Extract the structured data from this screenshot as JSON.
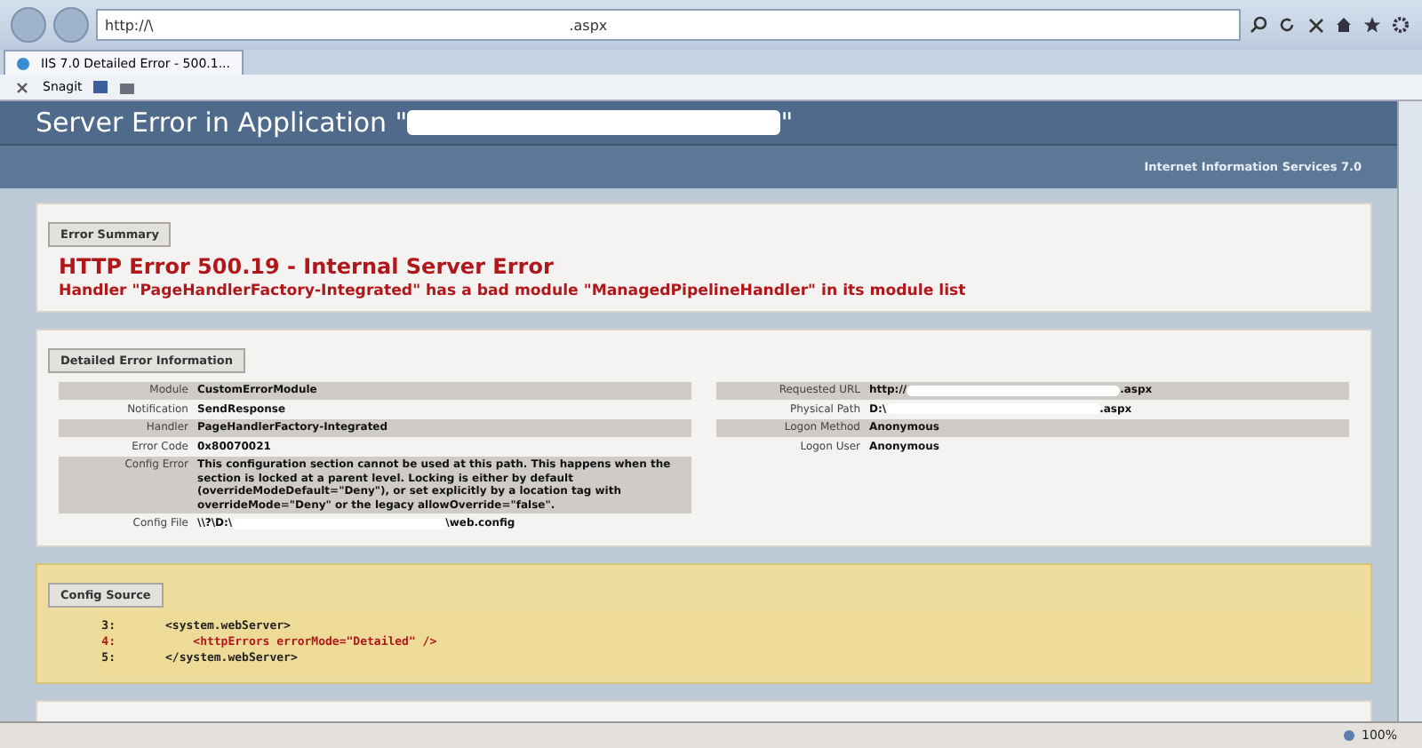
{
  "browser": {
    "address_prefix": "http://\\",
    "address_redacted": true,
    "address_suffix": ".aspx",
    "tabs": [
      {
        "title": "IIS 7.0 Detailed Error - 500.1...",
        "selected": true
      }
    ],
    "toolbar_label": "Snagit",
    "zoom": "100%"
  },
  "header": {
    "title_prefix": "Server Error in Application \"",
    "title_redacted": true,
    "title_suffix": "\"",
    "product": "Internet Information Services 7.0"
  },
  "summary": {
    "heading": "Error Summary",
    "title": "HTTP Error 500.19 - Internal Server Error",
    "message": "Handler \"PageHandlerFactory-Integrated\" has a bad module \"ManagedPipelineHandler\" in its module list"
  },
  "details": {
    "heading": "Detailed Error Information",
    "left": [
      {
        "label": "Module",
        "value": "CustomErrorModule",
        "redacted": false
      },
      {
        "label": "Notification",
        "value": "SendResponse",
        "redacted": false
      },
      {
        "label": "Handler",
        "value": "PageHandlerFactory-Integrated",
        "redacted": false
      },
      {
        "label": "Error Code",
        "value": "0x80070021",
        "redacted": false
      },
      {
        "label": "Config Error",
        "value": "This configuration section cannot be used at this path. This happens when the section is locked at a parent level. Locking is either by default (overrideModeDefault=\"Deny\"), or set explicitly by a location tag with overrideMode=\"Deny\" or the legacy allowOverride=\"false\".",
        "redacted": false
      },
      {
        "label": "Config File",
        "value": "\\\\?\\D:\\",
        "redacted": true,
        "value_end": "\\web.config"
      }
    ],
    "right": [
      {
        "label": "Requested URL",
        "value": "http://",
        "redacted": true,
        "value_end": ".aspx"
      },
      {
        "label": "Physical Path",
        "value": "D:\\",
        "redacted": true,
        "value_end": ".aspx"
      },
      {
        "label": "Logon Method",
        "value": "Anonymous",
        "redacted": false
      },
      {
        "label": "Logon User",
        "value": "Anonymous",
        "redacted": false
      }
    ]
  },
  "config_source": {
    "heading": "Config Source",
    "lines": [
      {
        "number": "3:",
        "code": "<system.webServer>",
        "highlighted": false
      },
      {
        "number": "4:",
        "code": "    <httpErrors errorMode=\"Detailed\" />",
        "highlighted": true
      },
      {
        "number": "5:",
        "code": "</system.webServer>",
        "highlighted": false
      }
    ]
  }
}
